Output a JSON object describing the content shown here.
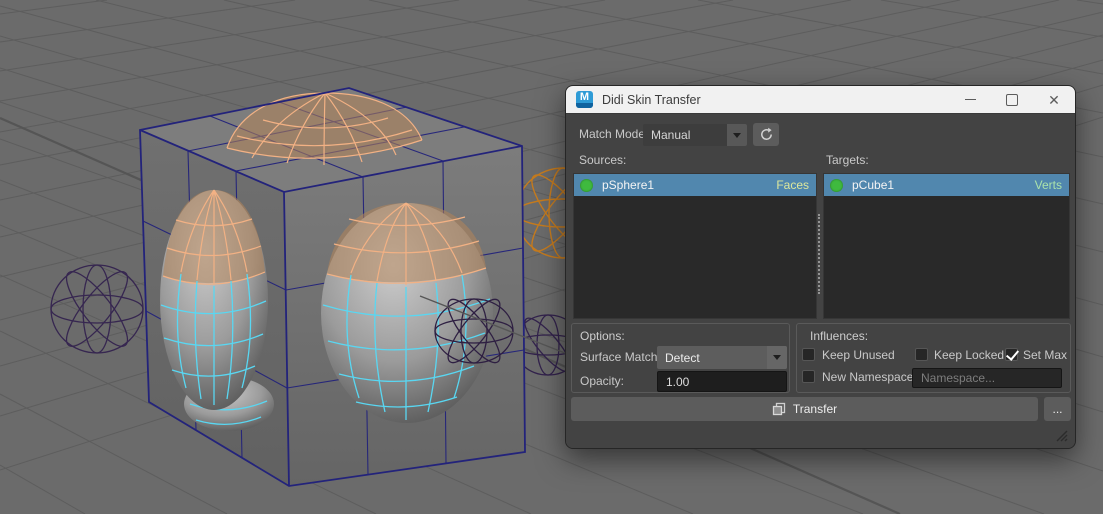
{
  "window": {
    "title": "Didi Skin Transfer"
  },
  "icons": {
    "maya_logo_text": "M",
    "close": "✕",
    "more": "..."
  },
  "toolbar": {
    "match_mode_label": "Match Mode:",
    "match_mode_value": "Manual"
  },
  "sources": {
    "label": "Sources:",
    "items": [
      {
        "name": "pSphere1",
        "mode": "Faces",
        "status_color": "#3fba3f"
      }
    ]
  },
  "targets": {
    "label": "Targets:",
    "items": [
      {
        "name": "pCube1",
        "mode": "Verts",
        "status_color": "#3fba3f"
      }
    ]
  },
  "options": {
    "title": "Options:",
    "surface_match_label": "Surface Match:",
    "surface_match_value": "Detect",
    "opacity_label": "Opacity:",
    "opacity_value": "1.00"
  },
  "influences": {
    "title": "Influences:",
    "keep_unused_label": "Keep Unused",
    "keep_unused_checked": false,
    "keep_locked_label": "Keep Locked",
    "keep_locked_checked": false,
    "set_max_label": "Set Max",
    "set_max_checked": true,
    "new_namespace_label": "New Namespace:",
    "new_namespace_checked": false,
    "namespace_placeholder": "Namespace..."
  },
  "actions": {
    "transfer_label": "Transfer",
    "more_label": "..."
  },
  "colors": {
    "titlebar_bg": "#f1f1f1",
    "panel_bg": "#434343",
    "list_bg": "#292929",
    "selection_blue": "#5187ae",
    "status_green": "#3fba3f",
    "faces_text": "#dde79c",
    "verts_text": "#abe3ab",
    "field_bg": "#1e1e1e",
    "button_bg": "#5c5c5c",
    "viewport_bg": "#6b6b6b",
    "wire_navy": "#23237b",
    "wire_orange": "#f2b184",
    "wire_cyan": "#55d6f2",
    "wire_purple": "#38285a",
    "wire_amber": "#c67b1d"
  }
}
